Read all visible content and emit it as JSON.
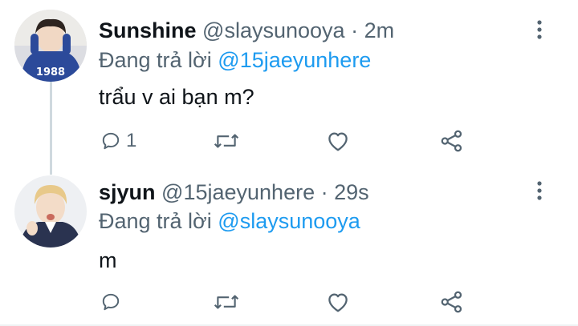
{
  "thread": [
    {
      "name": "Sunshine",
      "handle": "@slaysunooya",
      "separator": "·",
      "time": "2m",
      "reply_prefix": "Đang trả lời",
      "reply_to": "@15jaeyunhere",
      "text": "trẩu v ai bạn m?",
      "reply_count": "1",
      "avatar_jersey_text": "1988"
    },
    {
      "name": "sjyun",
      "handle": "@15jaeyunhere",
      "separator": "·",
      "time": "29s",
      "reply_prefix": "Đang trả lời",
      "reply_to": "@slaysunooya",
      "text": "m",
      "reply_count": ""
    }
  ],
  "icons": [
    "reply-icon",
    "retweet-icon",
    "like-icon",
    "share-icon",
    "more-options-icon"
  ],
  "colors": {
    "link": "#1d9bf0",
    "secondary_text": "#536471",
    "thread_line": "#cfd9de"
  }
}
